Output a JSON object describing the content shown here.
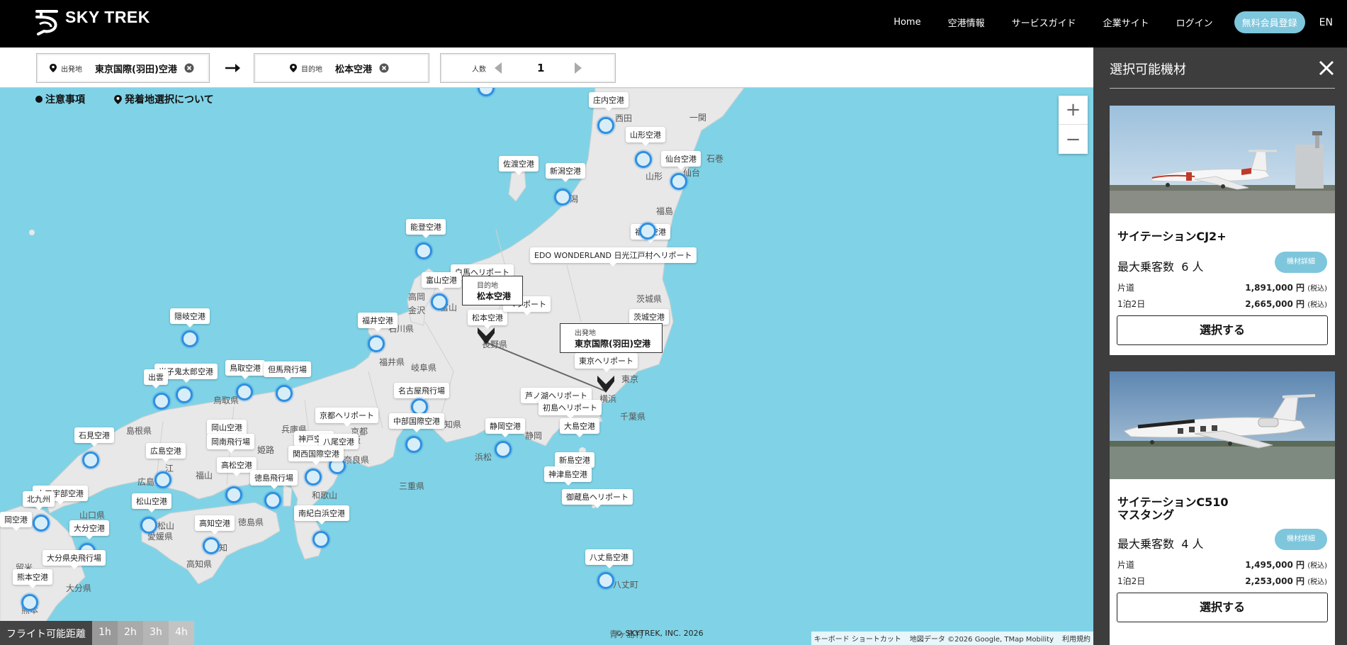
{
  "header": {
    "logo_text": "SKY TREK",
    "nav": [
      "Home",
      "空港情報",
      "サービスガイド",
      "企業サイト",
      "ログイン"
    ],
    "signup_label": "無料会員登録",
    "lang_label": "EN"
  },
  "search": {
    "origin_label": "出発地",
    "origin_value": "東京国際(羽田)空港",
    "dest_label": "目的地",
    "dest_value": "松本空港",
    "pax_label": "人数",
    "pax_value": "1"
  },
  "map": {
    "notice_link": "注意事項",
    "selection_link": "発着地選択について",
    "airports": [
      {
        "name": "庄内空港"
      },
      {
        "name": "山形空港"
      },
      {
        "name": "仙台空港"
      },
      {
        "name": "佐渡空港"
      },
      {
        "name": "新潟空港"
      },
      {
        "name": "福島空港"
      },
      {
        "name": "能登空港"
      },
      {
        "name": "EDO WONDERLAND 日光江戸村ヘリポート"
      },
      {
        "name": "白馬ヘリポート"
      },
      {
        "name": "富山空港"
      },
      {
        "name": "松本空港"
      },
      {
        "name": "ヘリポート"
      },
      {
        "name": "茨城空港"
      },
      {
        "name": "隠岐空港"
      },
      {
        "name": "福井空港"
      },
      {
        "name": "東京ヘリポート"
      },
      {
        "name": "米子鬼太郎空港"
      },
      {
        "name": "出雲"
      },
      {
        "name": "鳥取空港"
      },
      {
        "name": "但馬飛行場"
      },
      {
        "name": "名古屋飛行場"
      },
      {
        "name": "芦ノ湖ヘリポート"
      },
      {
        "name": "初島ヘリポート"
      },
      {
        "name": "京都ヘリポート"
      },
      {
        "name": "中部国際空港"
      },
      {
        "name": "静岡空港"
      },
      {
        "name": "大島空港"
      },
      {
        "name": "石見空港"
      },
      {
        "name": "岡山空港"
      },
      {
        "name": "岡南飛行場"
      },
      {
        "name": "神戸空港"
      },
      {
        "name": "八尾空港"
      },
      {
        "name": "広島空港"
      },
      {
        "name": "関西国際空港"
      },
      {
        "name": "新島空港"
      },
      {
        "name": "高松空港"
      },
      {
        "name": "神津島空港"
      },
      {
        "name": "徳島飛行場"
      },
      {
        "name": "御蔵島ヘリポート"
      },
      {
        "name": "山口宇部空港"
      },
      {
        "name": "北九州"
      },
      {
        "name": "松山空港"
      },
      {
        "name": "南紀白浜空港"
      },
      {
        "name": "岡空港"
      },
      {
        "name": "高知空港"
      },
      {
        "name": "大分空港"
      },
      {
        "name": "八丈島空港"
      },
      {
        "name": "大分県央飛行場"
      },
      {
        "name": "熊本空港"
      }
    ],
    "places": [
      "一関",
      "石巻",
      "仙台",
      "山形",
      "新潟",
      "福島",
      "茨城県",
      "東京",
      "横浜",
      "千葉県",
      "高岡",
      "金沢",
      "富山",
      "石川県",
      "長野県",
      "福井県",
      "岐阜県",
      "静岡",
      "浜松",
      "愛知県",
      "三重県",
      "京都",
      "大阪",
      "兵庫県",
      "姫路",
      "和歌山",
      "奈良県",
      "鳥取県",
      "島根県",
      "広島",
      "福山",
      "岡山県",
      "山口県",
      "松山",
      "高知",
      "高知県",
      "徳島県",
      "愛媛県",
      "熊本",
      "大分県",
      "留米",
      "八丈町",
      "青ヶ島村",
      "西田",
      "江"
    ],
    "dest_tag_sub": "目的地",
    "dest_tag_main": "松本空港",
    "origin_tag_sub": "出発地",
    "origin_tag_main": "東京国際(羽田)空港",
    "range_title": "フライト可能距離",
    "range_options": [
      "1h",
      "2h",
      "3h",
      "4h"
    ],
    "copyright": "© SKYTREK, INC. 2026",
    "attribution": [
      "キーボード ショートカット",
      "地図データ ©2026 Google, TMap Mobility",
      "利用規約"
    ]
  },
  "panel": {
    "title": "選択可能機材",
    "aircraft": [
      {
        "name": "サイテーションCJ2+",
        "capacity_label": "最大乗客数",
        "capacity_value": "6 人",
        "detail_label": "機材詳細",
        "oneway_label": "片道",
        "oneway_price": "1,891,000 円",
        "trip_label": "1泊2日",
        "trip_price": "2,665,000 円",
        "tax_label": "(税込)",
        "select_label": "選択する"
      },
      {
        "name": "サイテーションC510\nマスタング",
        "capacity_label": "最大乗客数",
        "capacity_value": "4 人",
        "detail_label": "機材詳細",
        "oneway_label": "片道",
        "oneway_price": "1,495,000 円",
        "trip_label": "1泊2日",
        "trip_price": "2,253,000 円",
        "tax_label": "(税込)",
        "select_label": "選択する"
      }
    ]
  }
}
